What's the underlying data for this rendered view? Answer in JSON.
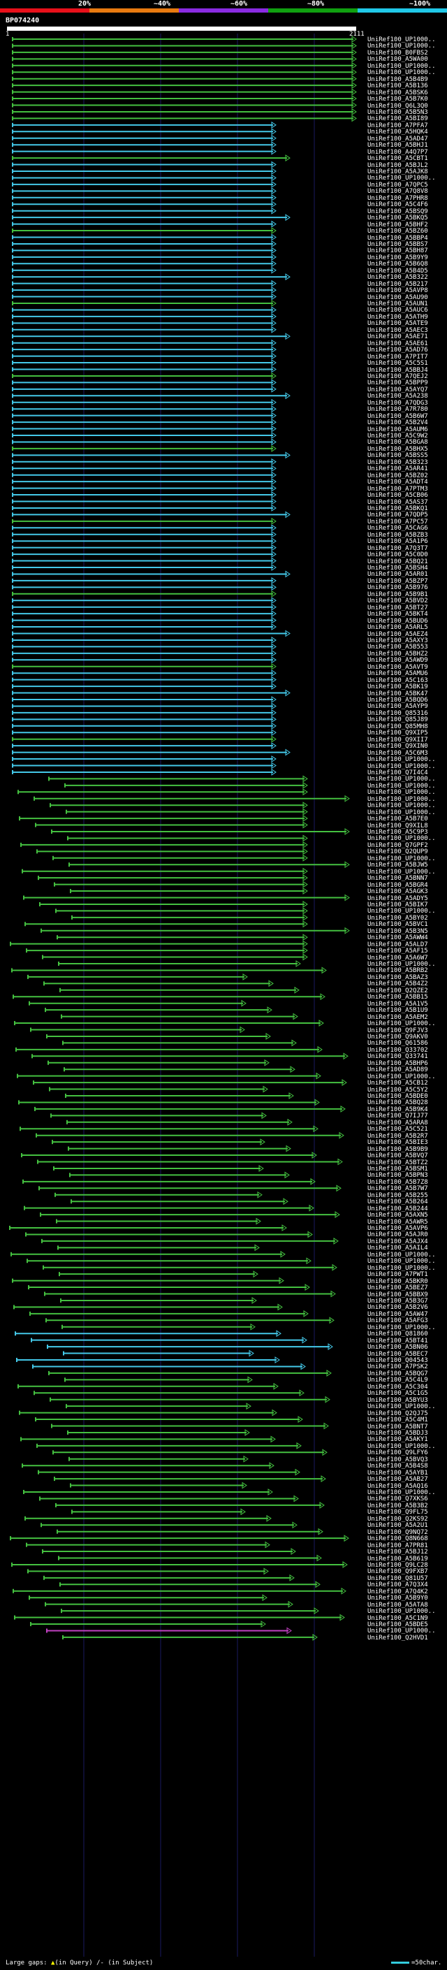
{
  "scale": {
    "labels": [
      "20%",
      "~40%",
      "~60%",
      "~80%",
      "~100%"
    ],
    "colors": [
      "#e8101a",
      "#e87a10",
      "#8a2be2",
      "#10a010",
      "#20c8e8"
    ]
  },
  "query": {
    "id": "BP074240",
    "start": "1",
    "end": "2111"
  },
  "colors": {
    "green": "#44c040",
    "cyan": "#44c8e8",
    "magenta": "#c040c0",
    "grid": "#1a1a60"
  },
  "hits": [
    "UniRef100_UP1000..",
    "UniRef100_UP1000..",
    "UniRef100_B0FBS2",
    "UniRef100_A5WA00",
    "UniRef100_UP1000..",
    "UniRef100_UP1000..",
    "UniRef100_A5B4B9",
    "UniRef100_A5B136",
    "UniRef100_A5BSK6",
    "UniRef100_A5B7K0",
    "UniRef100_Q6L3Q0",
    "UniRef100_A5B5N3",
    "UniRef100_A5BI89",
    "UniRef100_A7PFA7",
    "UniRef100_A5HQK4",
    "UniRef100_A5AD47",
    "UniRef100_A5BHJ1",
    "UniRef100_A4Q7P7",
    "UniRef100_A5CBT1",
    "UniRef100_A5BJL2",
    "UniRef100_A5AJK8",
    "UniRef100_UP1000..",
    "UniRef100_A7QPC5",
    "UniRef100_A7Q8V8",
    "UniRef100_A7PHR8",
    "UniRef100_A5C4F6",
    "UniRef100_A5BSQ9",
    "UniRef100_A5BKQ5",
    "UniRef100_A5BHF2",
    "UniRef100_A5BZ60",
    "UniRef100_A5BBP4",
    "UniRef100_A5BBS7",
    "UniRef100_A5BH87",
    "UniRef100_A5B9Y9",
    "UniRef100_A5B6Q8",
    "UniRef100_A5B4D5",
    "UniRef100_A5B322",
    "UniRef100_A5B217",
    "UniRef100_A5AVP8",
    "UniRef100_A5AU90",
    "UniRef100_A5AUN1",
    "UniRef100_A5AUC6",
    "UniRef100_A5ATH9",
    "UniRef100_A5ATE9",
    "UniRef100_A5AEC3",
    "UniRef100_A5AE71",
    "UniRef100_A5AE61",
    "UniRef100_A5AD76",
    "UniRef100_A7PIT7",
    "UniRef100_A5C5S1",
    "UniRef100_A5BBJ4",
    "UniRef100_A7QEJ2",
    "UniRef100_A5BPP9",
    "UniRef100_A5AYQ7",
    "UniRef100_A5A238",
    "UniRef100_A7QDG3",
    "UniRef100_A7R780",
    "UniRef100_A5B6W7",
    "UniRef100_A5B2V4",
    "UniRef100_A5AUM6",
    "UniRef100_A5C9W2",
    "UniRef100_A5BGA8",
    "UniRef100_A5BHX5",
    "UniRef100_A5BSS5",
    "UniRef100_A5B323",
    "UniRef100_A5AR41",
    "UniRef100_A5BZ02",
    "UniRef100_A5ADT4",
    "UniRef100_A7PTM3",
    "UniRef100_A5CB06",
    "UniRef100_A5AS37",
    "UniRef100_A5BKQ1",
    "UniRef100_A7QDP5",
    "UniRef100_A7PC57",
    "UniRef100_A5CAG6",
    "UniRef100_A5BZB3",
    "UniRef100_A5A1P6",
    "UniRef100_A7Q3T7",
    "UniRef100_A5C0D0",
    "UniRef100_A5BQ21",
    "UniRef100_A5BSH4",
    "UniRef100_A5AR01",
    "UniRef100_A5BZP7",
    "UniRef100_A5B976",
    "UniRef100_A5B9B1",
    "UniRef100_A5BVD2",
    "UniRef100_A5BT27",
    "UniRef100_A5BKT4",
    "UniRef100_A5BUD6",
    "UniRef100_A5ARL5",
    "UniRef100_A5AEZ4",
    "UniRef100_A5AXY3",
    "UniRef100_A5B553",
    "UniRef100_A5BHZ2",
    "UniRef100_A5AWD9",
    "UniRef100_A5AVT9",
    "UniRef100_A5AMU6",
    "UniRef100_A5C163",
    "UniRef100_A5BK19",
    "UniRef100_A5BK47",
    "UniRef100_A5BQD6",
    "UniRef100_A5AYP9",
    "UniRef100_Q85316",
    "UniRef100_Q85J89",
    "UniRef100_Q85MH8",
    "UniRef100_Q9XIP5",
    "UniRef100_Q9XII7",
    "UniRef100_Q9XIN0",
    "UniRef100_A5C6M3",
    "UniRef100_UP1000..",
    "UniRef100_UP1000..",
    "UniRef100_Q7I4C4",
    "UniRef100_UP1000..",
    "UniRef100_UP1000..",
    "UniRef100_UP1000..",
    "UniRef100_UP1000..",
    "UniRef100_UP1000..",
    "UniRef100_UP1000..",
    "UniRef100_A5B7E0",
    "UniRef100_Q9XIL8",
    "UniRef100_A5C9P3",
    "UniRef100_UP1000..",
    "UniRef100_Q7GPF2",
    "UniRef100_Q2QUP9",
    "UniRef100_UP1000..",
    "UniRef100_A5BJW5",
    "UniRef100_UP1000..",
    "UniRef100_A5BNN7",
    "UniRef100_A5BGR4",
    "UniRef100_A5AGK3",
    "UniRef100_A5ADY5",
    "UniRef100_A5BIK7",
    "UniRef100_UP1000..",
    "UniRef100_A5BY02",
    "UniRef100_A5BVC1",
    "UniRef100_A5B3N5",
    "UniRef100_A5AWW4",
    "UniRef100_A5ALD7",
    "UniRef100_A5AF15",
    "UniRef100_A5A6W7",
    "UniRef100_UP1000..",
    "UniRef100_A5BRB2",
    "UniRef100_A5BAZ3",
    "UniRef100_A5B4Z2",
    "UniRef100_Q2QZE2",
    "UniRef100_A5BB15",
    "UniRef100_A5A1V5",
    "UniRef100_A5B1U9",
    "UniRef100_A5AEM2",
    "UniRef100_UP1000..",
    "UniRef100_Q9FJV3",
    "UniRef100_Q9AKV0",
    "UniRef100_Q61586",
    "UniRef100_Q33702",
    "UniRef100_Q33741",
    "UniRef100_A5BHP6",
    "UniRef100_A5AD89",
    "UniRef100_UP1000..",
    "UniRef100_A5CB12",
    "UniRef100_A5C5Y2",
    "UniRef100_A5BDE0",
    "UniRef100_A5BQ28",
    "UniRef100_A5B9K4",
    "UniRef100_Q7IJ77",
    "UniRef100_A5ARA8",
    "UniRef100_A5C521",
    "UniRef100_A5B2R7",
    "UniRef100_A5BIE3",
    "UniRef100_A5B9B9",
    "UniRef100_A5BVQ7",
    "UniRef100_A5BTZ2",
    "UniRef100_A5BSM1",
    "UniRef100_A5BPN3",
    "UniRef100_A5B7Z8",
    "UniRef100_A5B7W7",
    "UniRef100_A5B255",
    "UniRef100_A5B264",
    "UniRef100_A5B244",
    "UniRef100_A5AXN5",
    "UniRef100_A5AWR5",
    "UniRef100_A5AVP6",
    "UniRef100_A5AJR0",
    "UniRef100_A5AJX4",
    "UniRef100_A5AIL4",
    "UniRef100_UP1000..",
    "UniRef100_UP1000..",
    "UniRef100_UP1000..",
    "UniRef100_A7PWT1",
    "UniRef100_A5BKR0",
    "UniRef100_A5BEZ7",
    "UniRef100_A5BBX9",
    "UniRef100_A5B3G7",
    "UniRef100_A5B2V6",
    "UniRef100_A5AW47",
    "UniRef100_A5AFG3",
    "UniRef100_UP1000..",
    "UniRef100_Q81860",
    "UniRef100_A5BT41",
    "UniRef100_A5BN06",
    "UniRef100_A5BEC7",
    "UniRef100_Q04543",
    "UniRef100_A7PSK2",
    "UniRef100_A5BQG7",
    "UniRef100_A5C4L9",
    "UniRef100_A5C304",
    "UniRef100_A5C1G5",
    "UniRef100_A5BYU3",
    "UniRef100_UP1000..",
    "UniRef100_Q2QJ75",
    "UniRef100_A5C4M1",
    "UniRef100_A5BNT7",
    "UniRef100_A5BDJ3",
    "UniRef100_A5AKY1",
    "UniRef100_UP1000..",
    "UniRef100_Q9LFY6",
    "UniRef100_A5BVQ3",
    "UniRef100_A5B4S8",
    "UniRef100_A5AYB1",
    "UniRef100_A5AB27",
    "UniRef100_A5AQ16",
    "UniRef100_UP1000..",
    "UniRef100_Q7XKS6",
    "UniRef100_A5B3B2",
    "UniRef100_Q9FL75",
    "UniRef100_Q2KS92",
    "UniRef100_A5A2U1",
    "UniRef100_Q9NQ72",
    "UniRef100_Q8N668",
    "UniRef100_A7PR81",
    "UniRef100_A5BJ12",
    "UniRef100_A5B619",
    "UniRef100_Q9LC28",
    "UniRef100_Q9FXB7",
    "UniRef100_Q81U57",
    "UniRef100_A7Q3X4",
    "UniRef100_A7Q4K2",
    "UniRef100_A5B9Y0",
    "UniRef100_A5ATA8",
    "UniRef100_UP1000..",
    "UniRef100_A5C1N9",
    "UniRef100_A5BDE5",
    "UniRef100_UP1000..",
    "UniRef100_Q2HVD1"
  ],
  "legend": {
    "gaps_text": "Large gaps:",
    "gap_query": "(in Query)",
    "gap_subject": "/- (in Subject)",
    "scale_text": "=50char."
  }
}
